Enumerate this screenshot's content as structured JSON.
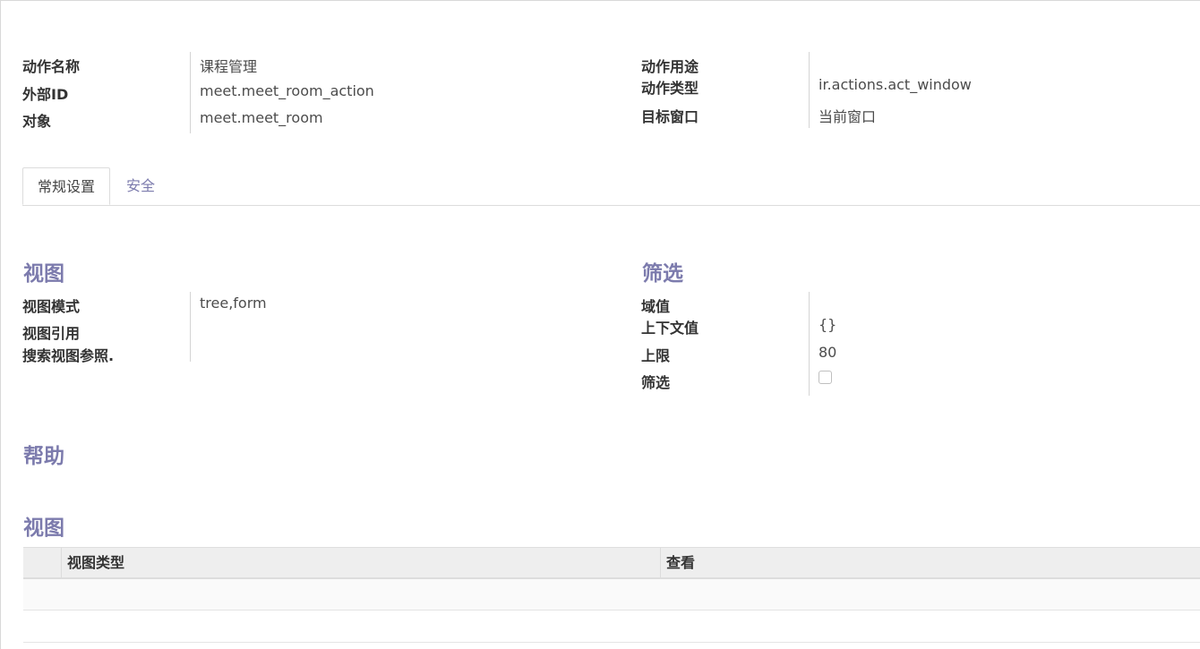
{
  "header": {
    "left": [
      {
        "label": "动作名称",
        "value": "课程管理"
      },
      {
        "label": "外部ID",
        "value": "meet.meet_room_action"
      },
      {
        "label": "对象",
        "value": "meet.meet_room"
      }
    ],
    "right": [
      {
        "label": "动作用途",
        "value": ""
      },
      {
        "label": "动作类型",
        "value": "ir.actions.act_window"
      },
      {
        "label": "目标窗口",
        "value": "当前窗口"
      }
    ]
  },
  "tabs": [
    {
      "label": "常规设置",
      "active": true
    },
    {
      "label": "安全",
      "active": false
    }
  ],
  "views_section": {
    "title": "视图",
    "fields": [
      {
        "label": "视图模式",
        "value": "tree,form"
      },
      {
        "label": "视图引用",
        "value": ""
      },
      {
        "label": "搜索视图参照.",
        "value": ""
      }
    ]
  },
  "filter_section": {
    "title": "筛选",
    "fields": [
      {
        "label": "域值",
        "value": ""
      },
      {
        "label": "上下文值",
        "value": "{}"
      },
      {
        "label": "上限",
        "value": "80"
      },
      {
        "label": "筛选",
        "value": "",
        "checked": false
      }
    ]
  },
  "help_section": {
    "title": "帮助"
  },
  "views_table": {
    "title": "视图",
    "columns": [
      "视图类型",
      "查看"
    ],
    "rows": []
  },
  "colors": {
    "accent": "#7c7bad",
    "header_bg": "#eeeeee"
  }
}
